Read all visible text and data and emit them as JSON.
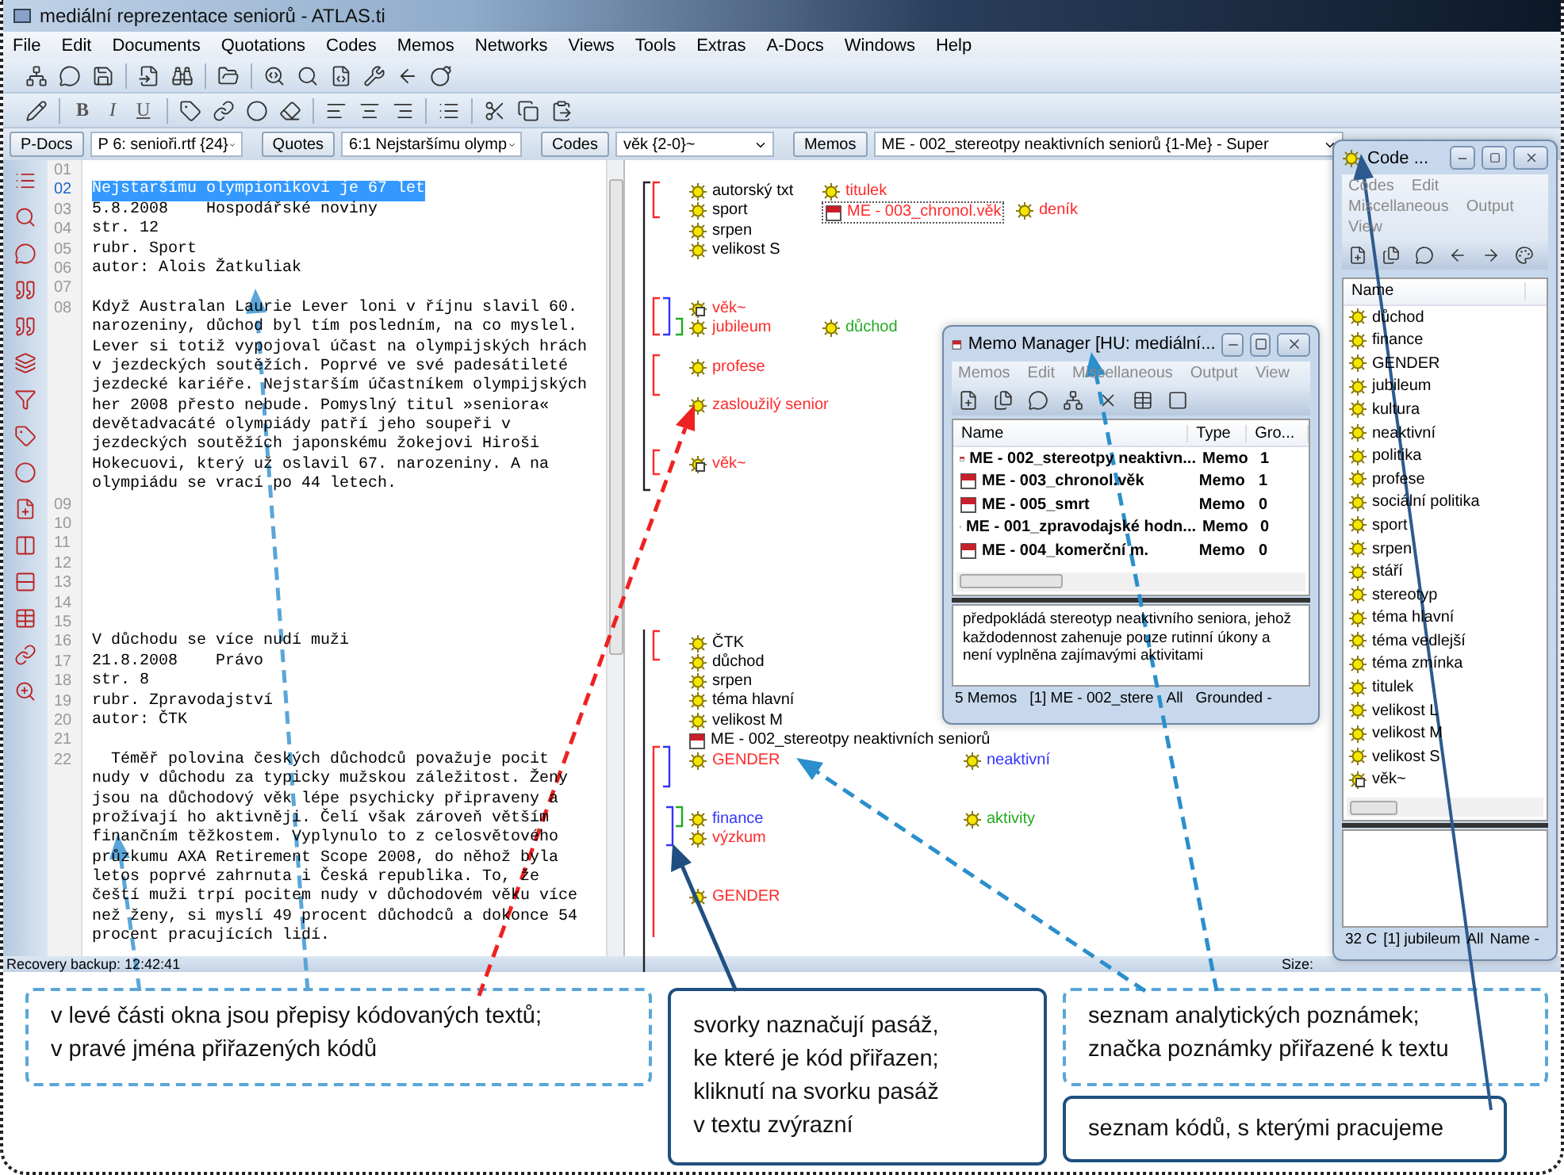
{
  "window": {
    "title": "mediální reprezentace seniorů - ATLAS.ti"
  },
  "menu": [
    "File",
    "Edit",
    "Documents",
    "Quotations",
    "Codes",
    "Memos",
    "Networks",
    "Views",
    "Tools",
    "Extras",
    "A-Docs",
    "Windows",
    "Help"
  ],
  "format_buttons": [
    "B",
    "I",
    "U"
  ],
  "selectors": [
    {
      "button": "P-Docs",
      "value": "P 6: senioři.rtf {24}"
    },
    {
      "button": "Quotes",
      "value": "6:1 Nejstaršímu olymp"
    },
    {
      "button": "Codes",
      "value": "věk {2-0}~"
    },
    {
      "button": "Memos",
      "value": "ME - 002_stereotpy neaktivních seniorů {1-Me} - Super"
    }
  ],
  "document": {
    "paragraphs": [
      {
        "number": "01",
        "selected": false
      },
      {
        "number": "02",
        "selected": true,
        "lines": [
          "Nejstaršímu olympionikovi je 67 let"
        ]
      },
      {
        "number": "03",
        "selected": false,
        "lines": [
          "5.8.2008    Hospodářské noviny"
        ]
      },
      {
        "number": "04",
        "selected": false,
        "lines": [
          "str. 12"
        ]
      },
      {
        "number": "05",
        "selected": false,
        "lines": [
          "rubr. Sport"
        ]
      },
      {
        "number": "06",
        "selected": false,
        "lines": [
          "autor: Alois Žatkuliak"
        ]
      },
      {
        "number": "07",
        "selected": false
      },
      {
        "number": "08",
        "selected": false,
        "lines": [
          "Když Australan Laurie Lever loni v říjnu slavil 60.",
          "narozeniny, důchod byl tím posledním, na co myslel.",
          "Lever si totiž vypojoval účast na olympijských hrách",
          "v jezdeckých soutěžích. Poprvé ve své padesátileté",
          "jezdecké kariéře. Nejstarším účastníkem olympijských",
          "her 2008 přesto nebude. Pomyslný titul »seniora«",
          "devětadvacáté olympiády patří jeho soupeři v",
          "jezdeckých soutěžích japonskému žokejovi Hiroši",
          "Hokecuovi, který už oslavil 67. narozeniny. A na",
          "olympiádu se vrací po 44 letech."
        ]
      },
      {
        "number": "09",
        "selected": false
      },
      {
        "number": "10",
        "selected": false
      },
      {
        "number": "11",
        "selected": false
      },
      {
        "number": "12",
        "selected": false
      },
      {
        "number": "13",
        "selected": false
      },
      {
        "number": "14",
        "selected": false
      },
      {
        "number": "15",
        "selected": false
      },
      {
        "number": "16",
        "selected": false,
        "lines": [
          "V důchodu se více nudí muži"
        ]
      },
      {
        "number": "17",
        "selected": false,
        "lines": [
          "21.8.2008    Právo"
        ]
      },
      {
        "number": "18",
        "selected": false,
        "lines": [
          "str. 8"
        ]
      },
      {
        "number": "19",
        "selected": false,
        "lines": [
          "rubr. Zpravodajství"
        ]
      },
      {
        "number": "20",
        "selected": false,
        "lines": [
          "autor: ČTK"
        ]
      },
      {
        "number": "21",
        "selected": false
      },
      {
        "number": "22",
        "selected": false,
        "lines": [
          "  Téměř polovina českých důchodců považuje pocit",
          "nudy v důchodu za typicky mužskou záležitost. Ženy",
          "jsou na důchodový věk lépe psychicky připraveny a",
          "prožívají ho aktivněji. Čelí však zároveň větším",
          "finančním těžkostem. Vyplynulo to z celosvětového",
          "průzkumu AXA Retirement Scope 2008, do něhož byla",
          "letos poprvé zahrnuta i Česká republika. To, že",
          "čeští muži trpí pocitem nudy v důchodovém věku více",
          "než ženy, si myslí 49 procent důchodců a dokonce 54",
          "procent pracujících lidí."
        ]
      }
    ]
  },
  "margin": [
    {
      "kind": "code",
      "label": "autorský txt",
      "color": "#000000",
      "selected": false
    },
    {
      "kind": "code",
      "label": "sport",
      "color": "#000000",
      "selected": false
    },
    {
      "kind": "code",
      "label": "srpen",
      "color": "#000000",
      "selected": false
    },
    {
      "kind": "code",
      "label": "velikost S",
      "color": "#000000",
      "selected": false
    },
    {
      "kind": "code",
      "label": "titulek",
      "color": "#ff2a2a",
      "selected": false
    },
    {
      "kind": "memo",
      "label": "ME - 003_chronol.věk",
      "color": "#ff2a2a",
      "selected": true
    },
    {
      "kind": "code",
      "label": "deník",
      "color": "#ff2a2a",
      "selected": false
    },
    {
      "kind": "family",
      "label": "věk~",
      "color": "#ff2a2a",
      "selected": false
    },
    {
      "kind": "code",
      "label": "jubileum",
      "color": "#ff2a2a",
      "selected": false
    },
    {
      "kind": "code",
      "label": "důchod",
      "color": "#22aa22",
      "selected": false
    },
    {
      "kind": "code",
      "label": "profese",
      "color": "#ff2a2a",
      "selected": false
    },
    {
      "kind": "code",
      "label": "zasloužilý senior",
      "color": "#ff2a2a",
      "selected": false
    },
    {
      "kind": "family",
      "label": "věk~",
      "color": "#ff2a2a",
      "selected": false
    },
    {
      "kind": "code",
      "label": "ČTK",
      "color": "#000000",
      "selected": false
    },
    {
      "kind": "code",
      "label": "důchod",
      "color": "#000000",
      "selected": false
    },
    {
      "kind": "code",
      "label": "srpen",
      "color": "#000000",
      "selected": false
    },
    {
      "kind": "code",
      "label": "téma hlavní",
      "color": "#000000",
      "selected": false
    },
    {
      "kind": "code",
      "label": "velikost M",
      "color": "#000000",
      "selected": false
    },
    {
      "kind": "memo",
      "label": "ME - 002_stereotpy neaktivních seniorů",
      "color": "#000000",
      "selected": false
    },
    {
      "kind": "code",
      "label": "GENDER",
      "color": "#ff2a2a",
      "selected": false
    },
    {
      "kind": "code",
      "label": "neaktivní",
      "color": "#3333ff",
      "selected": false
    },
    {
      "kind": "code",
      "label": "finance",
      "color": "#3333ff",
      "selected": false
    },
    {
      "kind": "code",
      "label": "výzkum",
      "color": "#ff2a2a",
      "selected": false
    },
    {
      "kind": "code",
      "label": "aktivity",
      "color": "#22aa22",
      "selected": false
    },
    {
      "kind": "code",
      "label": "GENDER",
      "color": "#ff2a2a",
      "selected": false
    }
  ],
  "status_bar": {
    "message": "Recovery backup: 12:42:41",
    "size_label": "Size:"
  },
  "memo_manager": {
    "title": "Memo Manager [HU: mediální...",
    "menu": [
      "Memos",
      "Edit",
      "Miscellaneous",
      "Output",
      "View"
    ],
    "columns": [
      "Name",
      "Type",
      "Gro..."
    ],
    "rows": [
      {
        "name": "ME - 002_stereotpy neaktivn...",
        "type": "Memo",
        "grounded": "1"
      },
      {
        "name": "ME - 003_chronol.věk",
        "type": "Memo",
        "grounded": "1"
      },
      {
        "name": "ME - 005_smrt",
        "type": "Memo",
        "grounded": "0"
      },
      {
        "name": "ME - 001_zpravodajské hodn...",
        "type": "Memo",
        "grounded": "0"
      },
      {
        "name": "ME - 004_komerční m.",
        "type": "Memo",
        "grounded": "0"
      }
    ],
    "memo_text": "předpokládá stereotyp neaktivního seniora, jehož každodennost zahenuje pouze rutinní úkony a není vyplněna zajímavými aktivitami",
    "status": [
      "5 Memos",
      "[1] ME - 002_stere",
      "All",
      "Grounded -"
    ]
  },
  "code_manager": {
    "title": "Code ...",
    "menu": [
      "Codes",
      "Edit",
      "Miscellaneous",
      "Output",
      "View"
    ],
    "column": "Name",
    "codes": [
      {
        "kind": "code",
        "name": "důchod"
      },
      {
        "kind": "code",
        "name": "finance"
      },
      {
        "kind": "code",
        "name": "GENDER"
      },
      {
        "kind": "code",
        "name": "jubileum"
      },
      {
        "kind": "code",
        "name": "kultura"
      },
      {
        "kind": "code",
        "name": "neaktivní"
      },
      {
        "kind": "code",
        "name": "politika"
      },
      {
        "kind": "code",
        "name": "profese"
      },
      {
        "kind": "code",
        "name": "sociální politika"
      },
      {
        "kind": "code",
        "name": "sport"
      },
      {
        "kind": "code",
        "name": "srpen"
      },
      {
        "kind": "code",
        "name": "stáří"
      },
      {
        "kind": "code",
        "name": "stereotyp"
      },
      {
        "kind": "code",
        "name": "téma hlavní"
      },
      {
        "kind": "code",
        "name": "téma vedlejší"
      },
      {
        "kind": "code",
        "name": "téma zmínka"
      },
      {
        "kind": "code",
        "name": "titulek"
      },
      {
        "kind": "code",
        "name": "velikost L"
      },
      {
        "kind": "code",
        "name": "velikost M"
      },
      {
        "kind": "code",
        "name": "velikost S"
      },
      {
        "kind": "family",
        "name": "věk~"
      }
    ],
    "status": [
      "32 C",
      "[1] jubileum",
      "All",
      "Name -"
    ]
  },
  "callouts": [
    {
      "kind": "dashed",
      "text": "v levé části okna jsou přepisy kódovaných textů;\nv pravé jména přiřazených kódů"
    },
    {
      "kind": "solid",
      "text": "svorky naznačují pasáž,\nke které je kód přiřazen;\nkliknutí na svorku pasáž\nv textu zvýrazní"
    },
    {
      "kind": "dashed",
      "text": "seznam analytických poznámek;\nznačka poznámky přiřazené k textu"
    },
    {
      "kind": "solid",
      "text": "seznam kódů, s kterými pracujeme"
    }
  ]
}
